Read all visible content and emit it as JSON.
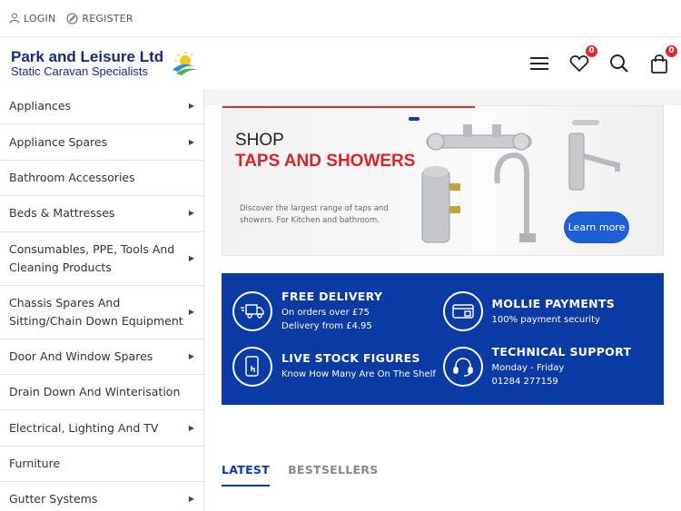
{
  "topbar": {
    "login": "LOGIN",
    "register": "REGISTER"
  },
  "logo": {
    "line1": "Park and Leisure Ltd",
    "line2": "Static Caravan Specialists"
  },
  "header": {
    "wishlist_count": "0",
    "cart_count": "0"
  },
  "sidebar": {
    "items": [
      {
        "label": "Appliances",
        "arrow": true
      },
      {
        "label": "Appliance Spares",
        "arrow": true
      },
      {
        "label": "Bathroom Accessories",
        "arrow": false
      },
      {
        "label": "Beds & Mattresses",
        "arrow": true
      },
      {
        "label": "Consumables, PPE, Tools And Cleaning Products",
        "arrow": true
      },
      {
        "label": "Chassis Spares And Sitting/Chain Down Equipment",
        "arrow": true
      },
      {
        "label": "Door And Window Spares",
        "arrow": true
      },
      {
        "label": "Drain Down And Winterisation",
        "arrow": false
      },
      {
        "label": "Electrical, Lighting And TV",
        "arrow": true
      },
      {
        "label": "Furniture",
        "arrow": false
      },
      {
        "label": "Gutter Systems",
        "arrow": true
      }
    ]
  },
  "banner": {
    "shop": "SHOP",
    "headline": "TAPS AND SHOWERS",
    "description": "Discover the largest range of taps and showers. For Kitchen and bathroom.",
    "cta": "Learn more"
  },
  "features": [
    {
      "title": "FREE DELIVERY",
      "line1": "On orders over £75",
      "line2": "Delivery from £4.95",
      "icon": "truck-icon"
    },
    {
      "title": "MOLLIE PAYMENTS",
      "line1": "100% payment security",
      "line2": "",
      "icon": "card-icon"
    },
    {
      "title": "LIVE STOCK FIGURES",
      "line1": "Know How Many Are On The Shelf",
      "line2": "",
      "icon": "phone-touch-icon"
    },
    {
      "title": "TECHNICAL SUPPORT",
      "line1": "Monday - Friday",
      "line2": "01284 277159",
      "icon": "headset-icon"
    }
  ],
  "tabs": {
    "latest": "LATEST",
    "bestsellers": "BESTSELLERS"
  },
  "colors": {
    "brand_blue": "#0a3aa3",
    "accent_red": "#d8232a",
    "button_blue": "#1e5fd6"
  }
}
